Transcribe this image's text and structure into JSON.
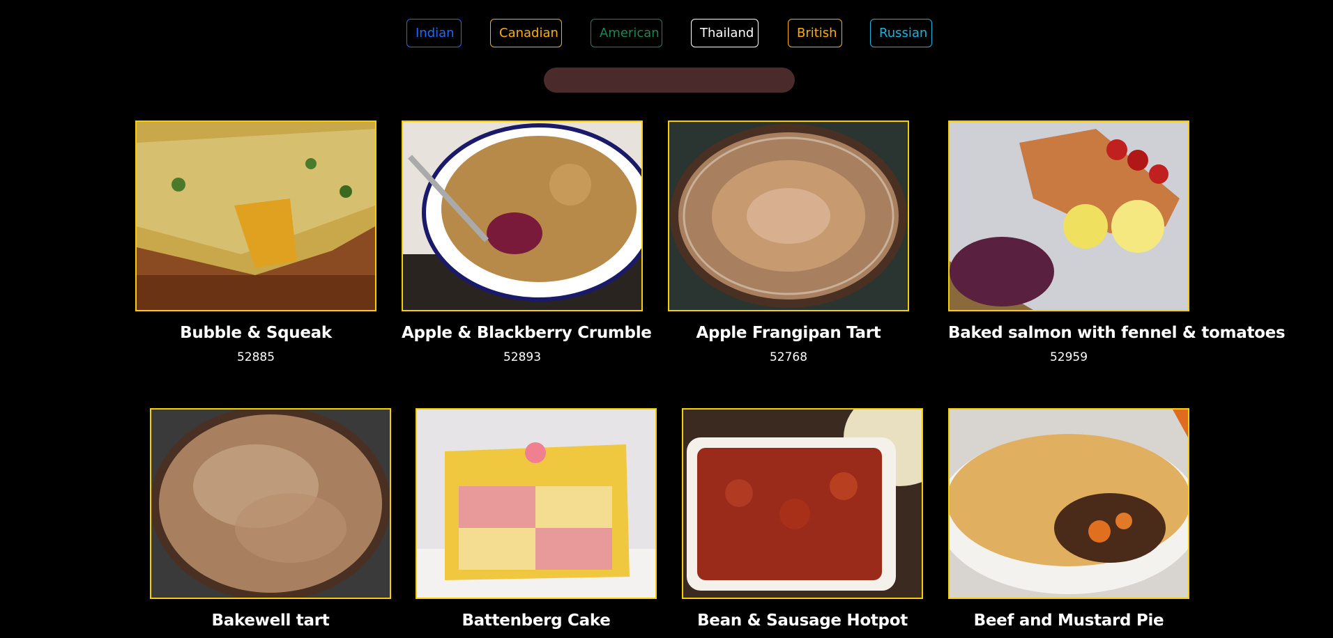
{
  "filters": [
    {
      "label": "Indian",
      "color": "#1a6cff"
    },
    {
      "label": "Canadian",
      "color": "#ffae00"
    },
    {
      "label": "American",
      "color": "#198754"
    },
    {
      "label": "Thailand",
      "color": "#ffffff"
    },
    {
      "label": "British",
      "color": "#ffae00"
    },
    {
      "label": "Russian",
      "color": "#1ab3e0"
    }
  ],
  "search": {
    "placeholder": "",
    "value": ""
  },
  "meals": [
    {
      "name": "Bubble & Squeak",
      "id": "52885"
    },
    {
      "name": "Apple & Blackberry Crumble",
      "id": "52893"
    },
    {
      "name": "Apple Frangipan Tart",
      "id": "52768"
    },
    {
      "name": "Baked salmon with fennel & tomatoes",
      "id": "52959"
    },
    {
      "name": "Bakewell tart",
      "id": ""
    },
    {
      "name": "Battenberg Cake",
      "id": ""
    },
    {
      "name": "Bean & Sausage Hotpot",
      "id": ""
    },
    {
      "name": "Beef and Mustard Pie",
      "id": ""
    }
  ],
  "colors": {
    "card_border": "#f5d000",
    "search_bg": "#4a2a2a",
    "background": "#000000"
  }
}
